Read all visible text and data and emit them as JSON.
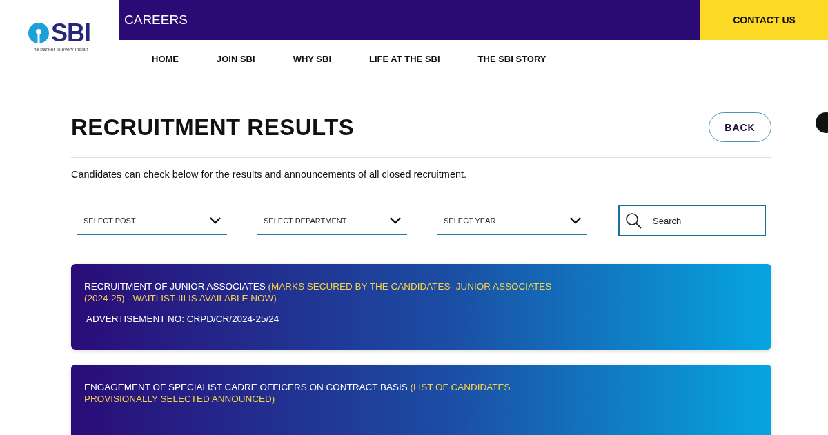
{
  "logo": {
    "name": "SBI",
    "tagline": "The banker to every Indian"
  },
  "header": {
    "title": "CAREERS",
    "contact": "CONTACT US"
  },
  "nav": [
    {
      "label": "HOME"
    },
    {
      "label": "JOIN SBI"
    },
    {
      "label": "WHY SBI"
    },
    {
      "label": "LIFE AT THE SBI"
    },
    {
      "label": "THE SBI STORY"
    }
  ],
  "page": {
    "title": "RECRUITMENT RESULTS",
    "back": "BACK",
    "intro": "Candidates can check below for the results and announcements of all closed recruitment."
  },
  "filters": [
    {
      "label": "SELECT POST"
    },
    {
      "label": "SELECT DEPARTMENT"
    },
    {
      "label": "SELECT YEAR"
    }
  ],
  "search": {
    "placeholder": "Search"
  },
  "results": [
    {
      "title": "RECRUITMENT OF JUNIOR ASSOCIATES",
      "status": "(MARKS SECURED BY THE CANDIDATES- JUNIOR ASSOCIATES (2024-25) - WAITLIST-III IS AVAILABLE NOW)",
      "advertisement": "ADVERTISEMENT NO: CRPD/CR/2024-25/24"
    },
    {
      "title": "ENGAGEMENT OF SPECIALIST CADRE OFFICERS ON CONTRACT BASIS",
      "status": "(LIST OF CANDIDATES PROVISIONALLY SELECTED ANNOUNCED)"
    }
  ]
}
